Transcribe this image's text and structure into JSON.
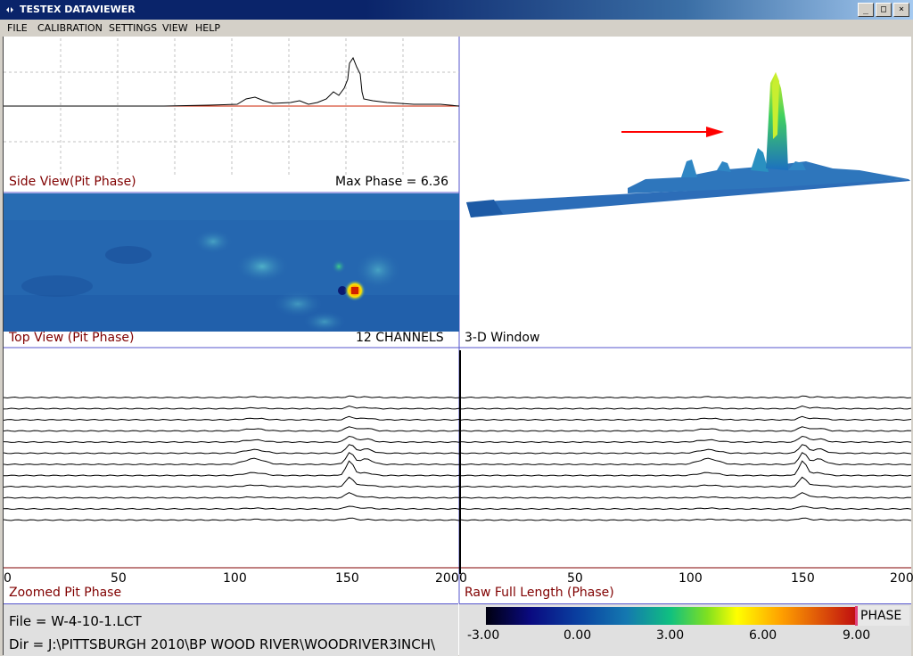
{
  "window": {
    "title": "TESTEX DATAVIEWER",
    "minimize": "_",
    "maximize": "□",
    "close": "×"
  },
  "menu": [
    "FILE",
    "CALIBRATION",
    "SETTINGS",
    "VIEW",
    "HELP"
  ],
  "side_view": {
    "label": "Side View(Pit Phase)",
    "readout": "Max Phase = 6.36"
  },
  "top_view": {
    "label": "Top View (Pit Phase)",
    "readout": "12 CHANNELS"
  },
  "window_3d": {
    "label": "3-D Window"
  },
  "zoomed": {
    "label": "Zoomed Pit Phase",
    "ticks": [
      "0",
      "50",
      "100",
      "150",
      "200"
    ]
  },
  "raw": {
    "label": "Raw Full Length (Phase)",
    "ticks": [
      "0",
      "50",
      "100",
      "150",
      "200"
    ]
  },
  "status": {
    "file": "File = W-4-10-1.LCT",
    "dir": "Dir = J:\\PITTSBURGH 2010\\BP WOOD RIVER\\WOODRIVER3INCH\\"
  },
  "colorbar": {
    "title": "PHASE",
    "ticks": [
      "-3.00",
      "0.00",
      "3.00",
      "6.00",
      "9.00"
    ]
  },
  "colors": {
    "title_start": "#0a246a",
    "trace": "#000000",
    "baseline": "#cc2200",
    "arrow": "#ff0000",
    "panel_border": "#5555cc"
  },
  "icons": [
    "app-icon",
    "minimize-icon",
    "maximize-icon",
    "close-icon",
    "red-arrow-icon"
  ],
  "chart_data": [
    {
      "type": "line",
      "title": "Side View(Pit Phase)",
      "xlabel": "",
      "ylabel": "",
      "x": [
        0,
        20,
        40,
        60,
        80,
        90,
        100,
        105,
        110,
        115,
        120,
        125,
        130,
        135,
        140,
        145,
        148,
        150,
        152,
        155,
        158,
        160,
        165,
        170,
        180,
        190,
        200
      ],
      "series": [
        {
          "name": "",
          "values": [
            0,
            0,
            0,
            0,
            0.05,
            0.2,
            0.25,
            0.6,
            0.9,
            0.7,
            0.4,
            0.3,
            0.4,
            1.0,
            0.5,
            1.1,
            2.3,
            3.6,
            6.36,
            5.2,
            3.2,
            1.5,
            0.9,
            0.4,
            0.2,
            0.1,
            0
          ]
        }
      ]
    },
    {
      "type": "line",
      "title": "Zoomed Pit Phase",
      "xlabel": "",
      "ylabel": "",
      "x_ticks": [
        0,
        50,
        100,
        150,
        200
      ],
      "series": [
        {
          "name": "",
          "values": [
            0,
            0,
            0.1,
            0.1,
            0.3,
            0.1,
            0
          ]
        },
        {
          "name": "",
          "values": [
            0,
            0,
            0.1,
            0.2,
            0.5,
            0.2,
            0
          ]
        },
        {
          "name": "",
          "values": [
            0,
            0,
            0.2,
            0.3,
            0.7,
            0.4,
            0
          ]
        },
        {
          "name": "",
          "values": [
            0,
            0,
            0.3,
            0.5,
            1.0,
            0.5,
            0
          ]
        },
        {
          "name": "",
          "values": [
            0,
            0,
            0.3,
            0.6,
            1.4,
            0.6,
            0
          ]
        },
        {
          "name": "",
          "values": [
            0,
            0,
            0.5,
            0.8,
            2.0,
            0.7,
            0
          ]
        },
        {
          "name": "",
          "values": [
            0,
            0,
            0.8,
            1.0,
            2.6,
            0.8,
            0
          ]
        },
        {
          "name": "",
          "values": [
            0,
            0,
            0.4,
            0.5,
            3.2,
            0.5,
            0
          ]
        },
        {
          "name": "",
          "values": [
            0,
            0,
            0.2,
            0.3,
            2.1,
            0.4,
            0
          ]
        },
        {
          "name": "",
          "values": [
            0,
            0,
            0.1,
            0.2,
            1.2,
            0.3,
            0
          ]
        },
        {
          "name": "",
          "values": [
            0,
            0,
            0.1,
            0.2,
            0.7,
            0.2,
            0
          ]
        },
        {
          "name": "",
          "values": [
            0,
            0,
            0.1,
            0.1,
            0.5,
            0.1,
            0
          ]
        }
      ]
    },
    {
      "type": "heatmap",
      "title": "Top View (Pit Phase)",
      "channels": 12,
      "value_range": [
        -3,
        9
      ],
      "peak": {
        "x": 153,
        "channel": 7,
        "value": 6.36
      }
    }
  ]
}
